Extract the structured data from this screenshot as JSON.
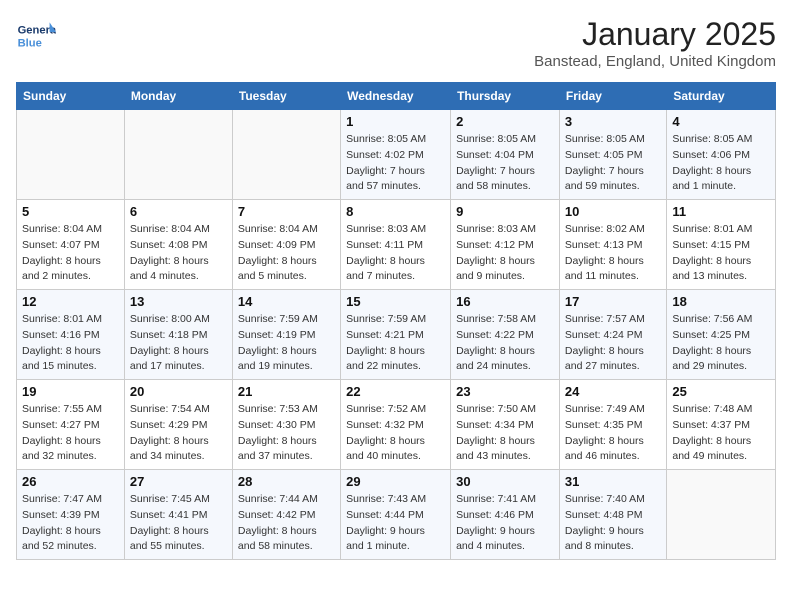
{
  "header": {
    "logo_text_general": "General",
    "logo_text_blue": "Blue",
    "month": "January 2025",
    "location": "Banstead, England, United Kingdom"
  },
  "weekdays": [
    "Sunday",
    "Monday",
    "Tuesday",
    "Wednesday",
    "Thursday",
    "Friday",
    "Saturday"
  ],
  "weeks": [
    [
      {
        "day": "",
        "info": ""
      },
      {
        "day": "",
        "info": ""
      },
      {
        "day": "",
        "info": ""
      },
      {
        "day": "1",
        "info": "Sunrise: 8:05 AM\nSunset: 4:02 PM\nDaylight: 7 hours and 57 minutes."
      },
      {
        "day": "2",
        "info": "Sunrise: 8:05 AM\nSunset: 4:04 PM\nDaylight: 7 hours and 58 minutes."
      },
      {
        "day": "3",
        "info": "Sunrise: 8:05 AM\nSunset: 4:05 PM\nDaylight: 7 hours and 59 minutes."
      },
      {
        "day": "4",
        "info": "Sunrise: 8:05 AM\nSunset: 4:06 PM\nDaylight: 8 hours and 1 minute."
      }
    ],
    [
      {
        "day": "5",
        "info": "Sunrise: 8:04 AM\nSunset: 4:07 PM\nDaylight: 8 hours and 2 minutes."
      },
      {
        "day": "6",
        "info": "Sunrise: 8:04 AM\nSunset: 4:08 PM\nDaylight: 8 hours and 4 minutes."
      },
      {
        "day": "7",
        "info": "Sunrise: 8:04 AM\nSunset: 4:09 PM\nDaylight: 8 hours and 5 minutes."
      },
      {
        "day": "8",
        "info": "Sunrise: 8:03 AM\nSunset: 4:11 PM\nDaylight: 8 hours and 7 minutes."
      },
      {
        "day": "9",
        "info": "Sunrise: 8:03 AM\nSunset: 4:12 PM\nDaylight: 8 hours and 9 minutes."
      },
      {
        "day": "10",
        "info": "Sunrise: 8:02 AM\nSunset: 4:13 PM\nDaylight: 8 hours and 11 minutes."
      },
      {
        "day": "11",
        "info": "Sunrise: 8:01 AM\nSunset: 4:15 PM\nDaylight: 8 hours and 13 minutes."
      }
    ],
    [
      {
        "day": "12",
        "info": "Sunrise: 8:01 AM\nSunset: 4:16 PM\nDaylight: 8 hours and 15 minutes."
      },
      {
        "day": "13",
        "info": "Sunrise: 8:00 AM\nSunset: 4:18 PM\nDaylight: 8 hours and 17 minutes."
      },
      {
        "day": "14",
        "info": "Sunrise: 7:59 AM\nSunset: 4:19 PM\nDaylight: 8 hours and 19 minutes."
      },
      {
        "day": "15",
        "info": "Sunrise: 7:59 AM\nSunset: 4:21 PM\nDaylight: 8 hours and 22 minutes."
      },
      {
        "day": "16",
        "info": "Sunrise: 7:58 AM\nSunset: 4:22 PM\nDaylight: 8 hours and 24 minutes."
      },
      {
        "day": "17",
        "info": "Sunrise: 7:57 AM\nSunset: 4:24 PM\nDaylight: 8 hours and 27 minutes."
      },
      {
        "day": "18",
        "info": "Sunrise: 7:56 AM\nSunset: 4:25 PM\nDaylight: 8 hours and 29 minutes."
      }
    ],
    [
      {
        "day": "19",
        "info": "Sunrise: 7:55 AM\nSunset: 4:27 PM\nDaylight: 8 hours and 32 minutes."
      },
      {
        "day": "20",
        "info": "Sunrise: 7:54 AM\nSunset: 4:29 PM\nDaylight: 8 hours and 34 minutes."
      },
      {
        "day": "21",
        "info": "Sunrise: 7:53 AM\nSunset: 4:30 PM\nDaylight: 8 hours and 37 minutes."
      },
      {
        "day": "22",
        "info": "Sunrise: 7:52 AM\nSunset: 4:32 PM\nDaylight: 8 hours and 40 minutes."
      },
      {
        "day": "23",
        "info": "Sunrise: 7:50 AM\nSunset: 4:34 PM\nDaylight: 8 hours and 43 minutes."
      },
      {
        "day": "24",
        "info": "Sunrise: 7:49 AM\nSunset: 4:35 PM\nDaylight: 8 hours and 46 minutes."
      },
      {
        "day": "25",
        "info": "Sunrise: 7:48 AM\nSunset: 4:37 PM\nDaylight: 8 hours and 49 minutes."
      }
    ],
    [
      {
        "day": "26",
        "info": "Sunrise: 7:47 AM\nSunset: 4:39 PM\nDaylight: 8 hours and 52 minutes."
      },
      {
        "day": "27",
        "info": "Sunrise: 7:45 AM\nSunset: 4:41 PM\nDaylight: 8 hours and 55 minutes."
      },
      {
        "day": "28",
        "info": "Sunrise: 7:44 AM\nSunset: 4:42 PM\nDaylight: 8 hours and 58 minutes."
      },
      {
        "day": "29",
        "info": "Sunrise: 7:43 AM\nSunset: 4:44 PM\nDaylight: 9 hours and 1 minute."
      },
      {
        "day": "30",
        "info": "Sunrise: 7:41 AM\nSunset: 4:46 PM\nDaylight: 9 hours and 4 minutes."
      },
      {
        "day": "31",
        "info": "Sunrise: 7:40 AM\nSunset: 4:48 PM\nDaylight: 9 hours and 8 minutes."
      },
      {
        "day": "",
        "info": ""
      }
    ]
  ]
}
